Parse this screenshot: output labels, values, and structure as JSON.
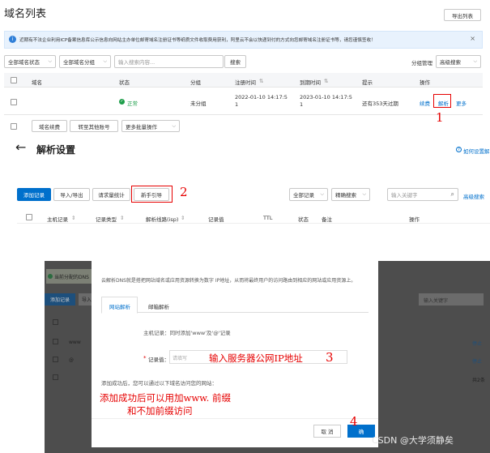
{
  "top": {
    "title": "域名列表",
    "export_btn": "导出列表",
    "notice": "近期有不法企业利用ICP备案信息库公示信息向网站主办单位邮寄域名注册证书等纸质文件收取费用获利，阿里云不会以快递到付的方式向您邮寄域名注册证书等，请您谨慎签收！",
    "filter_status": "全部域名状态",
    "filter_group": "全部域名分组",
    "search_placeholder": "输入搜索内容...",
    "search_btn": "搜索",
    "group_manage": "分组管理",
    "advanced_search": "高级搜索",
    "columns": [
      "域名",
      "状态",
      "分组",
      "注册时间",
      "到期时间",
      "提示",
      "操作"
    ],
    "row": {
      "status": "正常",
      "group": "未分组",
      "reg_time": "2022-01-10 14:17:5\n1",
      "exp_time": "2023-01-10 14:17:5\n1",
      "tip": "还有353天过期",
      "renew": "续费",
      "resolve": "解析",
      "more": "更多"
    },
    "bulk_renew": "域名续费",
    "bulk_transfer": "转至其他账号",
    "bulk_more": "更多批量操作"
  },
  "resolve": {
    "back": "←",
    "title": "解析设置",
    "help": "如何设置解",
    "add_record": "添加记录",
    "import_export": "导入/导出",
    "request_stats": "请求量统计",
    "newbie_guide": "新手引导",
    "all_records": "全部记录",
    "exact_search": "精确搜索",
    "keyword_placeholder": "输入关键字",
    "advanced_search": "高级搜索",
    "columns": [
      "主机记录",
      "记录类型",
      "解析线路(isp)",
      "记录值",
      "TTL",
      "状态",
      "备注",
      "操作"
    ]
  },
  "bg": {
    "banner": "当前分配的DNS",
    "add_record": "添加记录",
    "import": "导入",
    "rows": [
      "www",
      "@"
    ],
    "stop": "停止",
    "total": "共2条",
    "search_placeholder": "输入关键字"
  },
  "modal": {
    "desc": "云解析DNS就是搭把网站域名或应用资源转换为数字 IP地址，从而将最终用户的访问路由到相应的网站或应用资源上。",
    "tab_website": "网站解析",
    "tab_mail": "邮箱解析",
    "host_record": "主机记录：同时添加'www'及'@'记录",
    "record_value_label": "记录值：",
    "record_value_placeholder": "请填写",
    "success_note": "添加成功后，您可以通过以下域名访问您的网站：",
    "cancel": "取 消",
    "confirm": "确"
  },
  "annotations": {
    "n1": "1",
    "n2": "2",
    "n3": "3",
    "n4": "4",
    "ip_hint": "输入服务器公网IP地址",
    "www_hint1": "添加成功后可以用加www. 前缀",
    "www_hint2": "和不加前缀访问"
  },
  "watermark": "CSDN @大学须静矣",
  "colors": {
    "primary": "#0070cc",
    "annotation_red": "#e60000",
    "success_green": "#1e9e4a",
    "notice_bg": "#e8f2fd",
    "overlay": "#4d4d4d"
  }
}
